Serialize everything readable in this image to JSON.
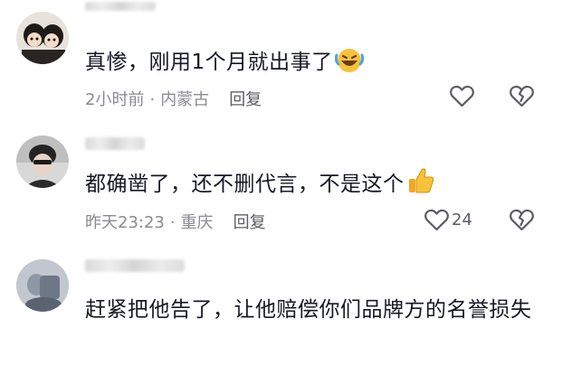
{
  "comments": [
    {
      "text": "真惨，刚用1个月就出事了",
      "emoji": "rolling-laughing-emoji",
      "time": "2小时前",
      "separator": "·",
      "location": "内蒙古",
      "reply": "回复",
      "like_count": ""
    },
    {
      "text": "都确凿了，还不删代言，不是这个",
      "emoji": "thumbs-up-emoji",
      "time": "昨天23:23",
      "separator": "·",
      "location": "重庆",
      "reply": "回复",
      "like_count": "24"
    },
    {
      "text": "赶紧把他告了，让他赔偿你们品牌方的名誉损失",
      "emoji": "",
      "time": "",
      "separator": "",
      "location": "",
      "reply": "",
      "like_count": ""
    }
  ],
  "colors": {
    "text": "#161823",
    "meta": "#8a8b91",
    "icon": "#5c5d63"
  }
}
